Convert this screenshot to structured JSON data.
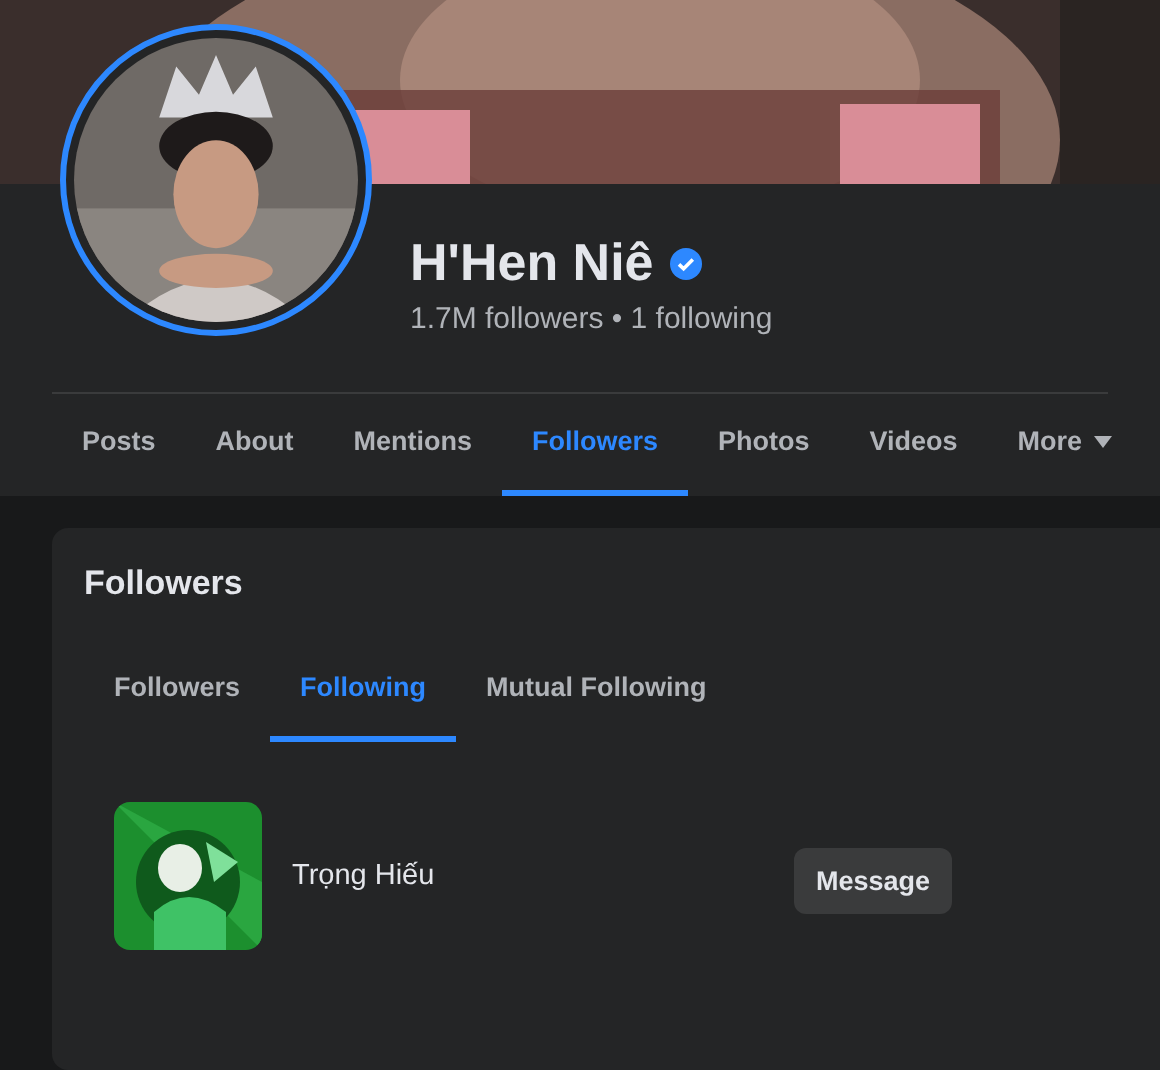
{
  "profile": {
    "name": "H'Hen Niê",
    "verified": true,
    "stats": "1.7M followers • 1 following",
    "has_story": true
  },
  "tabs": [
    {
      "label": "Posts",
      "selected": false
    },
    {
      "label": "About",
      "selected": false
    },
    {
      "label": "Mentions",
      "selected": false
    },
    {
      "label": "Followers",
      "selected": true
    },
    {
      "label": "Photos",
      "selected": false
    },
    {
      "label": "Videos",
      "selected": false
    },
    {
      "label": "More",
      "selected": false,
      "dropdown": true
    }
  ],
  "card": {
    "title": "Followers",
    "subtabs": [
      {
        "label": "Followers",
        "selected": false
      },
      {
        "label": "Following",
        "selected": true
      },
      {
        "label": "Mutual Following",
        "selected": false
      }
    ],
    "people": [
      {
        "name": "Trọng Hiếu",
        "button": "Message"
      }
    ]
  }
}
